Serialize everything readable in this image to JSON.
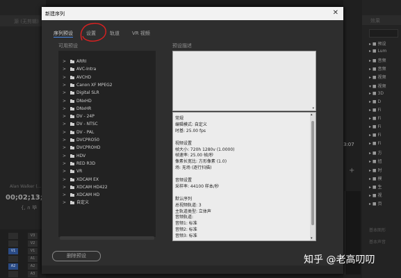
{
  "background": {
    "left_panel_title": "源 (无剪辑)",
    "left_clip_name": "Alan Walker (...",
    "left_timecode": "00;02;13;2",
    "left_controls": "{,  ∩  毕",
    "tracks": [
      {
        "a": "",
        "b": "V3",
        "blue": false
      },
      {
        "a": "",
        "b": "V2",
        "blue": false
      },
      {
        "a": "V1",
        "b": "V1",
        "blue": true
      },
      {
        "a": "",
        "b": "A1",
        "blue": false
      },
      {
        "a": "A2",
        "b": "A2",
        "blue": true
      },
      {
        "a": "",
        "b": "A3",
        "blue": false
      }
    ],
    "mid_timecode": "3:07",
    "mid_plus": "+",
    "right_panel_title": "效果",
    "right_items": [
      "▸ ■ 预设",
      "▸ ■ Lum",
      "▸ ■ 音频",
      "▸ ■ 音频",
      "▸ ■ 视频",
      "▾ ■ 视频",
      "▸ ■ 3D",
      "▸ ■ D",
      "▸ ■ Fi",
      "▸ ■ Fi",
      "▸ ■ Fi",
      "▸ ■ Fi",
      "▸ ■ Fi",
      "▸ ■ 方",
      "▸ ■ 扭",
      "▸ ■ 时",
      "▸ ■ 模",
      "▸ ■ 生",
      "▸ ■ 视",
      "▸ ■ 页"
    ],
    "right_foot1": "基本图形",
    "right_foot2": "基本声音"
  },
  "dialog": {
    "title": "新建序列",
    "close_glyph": "✕",
    "tabs": [
      "序列预设",
      "设置",
      "轨道",
      "VR 视频"
    ],
    "available_presets_label": "可用预设",
    "preset_description_label": "预设描述",
    "presets": [
      "ARRI",
      "AVC-Intra",
      "AVCHD",
      "Canon XF MPEG2",
      "Digital SLR",
      "DNxHD",
      "DNxHR",
      "DV - 24P",
      "DV - NTSC",
      "DV - PAL",
      "DVCPRO50",
      "DVCPROHD",
      "HDV",
      "RED R3D",
      "VR",
      "XDCAM EX",
      "XDCAM HD422",
      "XDCAM HD",
      "自定义"
    ],
    "info_lines": [
      "常规",
      " 编辑模式: 自定义",
      " 时基: 25.00 fps",
      "",
      "视频设置",
      " 帧大小: 720h 1280v (1.0000)",
      " 帧速率: 25.00 帧/秒",
      " 像素长宽比: 方形像素 (1.0)",
      " 场: 无场 (逐行扫描)",
      "",
      "音频设置",
      " 采样率: 44100 样本/秒",
      "",
      "默认序列",
      " 总视频轨道: 3",
      " 主轨道类型: 立体声",
      " 音频轨道:",
      " 音频1: 标准",
      " 音频2: 标准",
      " 音频3: 标准"
    ],
    "delete_preset_label": "删除预设"
  },
  "watermark": "知乎 @老高叨叨",
  "colors": {
    "accent": "#4a8ef0",
    "annotation": "#e02020",
    "track_blue": "#2a4b86"
  }
}
